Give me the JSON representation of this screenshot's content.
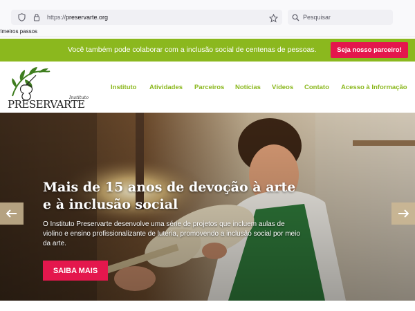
{
  "browser": {
    "url_scheme": "https://",
    "url_domain": "preservarte.org",
    "search_placeholder": "Pesquisar",
    "bookmark_label": "rimeiros passos"
  },
  "banner": {
    "text": "Você também pode colaborar com a inclusão social de centenas de pessoas.",
    "button_label": "Seja nosso parceiro!",
    "color": "#8bb81e",
    "button_color": "#e4174d"
  },
  "logo": {
    "small_text": "Instituto",
    "word": "PRESERVARTE"
  },
  "nav": {
    "items": [
      "Instituto",
      "Atividades",
      "Parceiros",
      "Notícias",
      "Vídeos",
      "Contato",
      "Acesso à Informação"
    ],
    "color": "#8bb81e"
  },
  "hero": {
    "title": "Mais de 15 anos de devoção à arte e à inclusão social",
    "description": "O Instituto Preservarte desenvolve uma série de projetos que incluem aulas de violino e ensino profissionalizante de luteria, promovendo a inclusão social por meio da arte.",
    "cta_label": "SAIBA MAIS",
    "prev_icon": "arrow-left-icon",
    "next_icon": "arrow-right-icon"
  }
}
